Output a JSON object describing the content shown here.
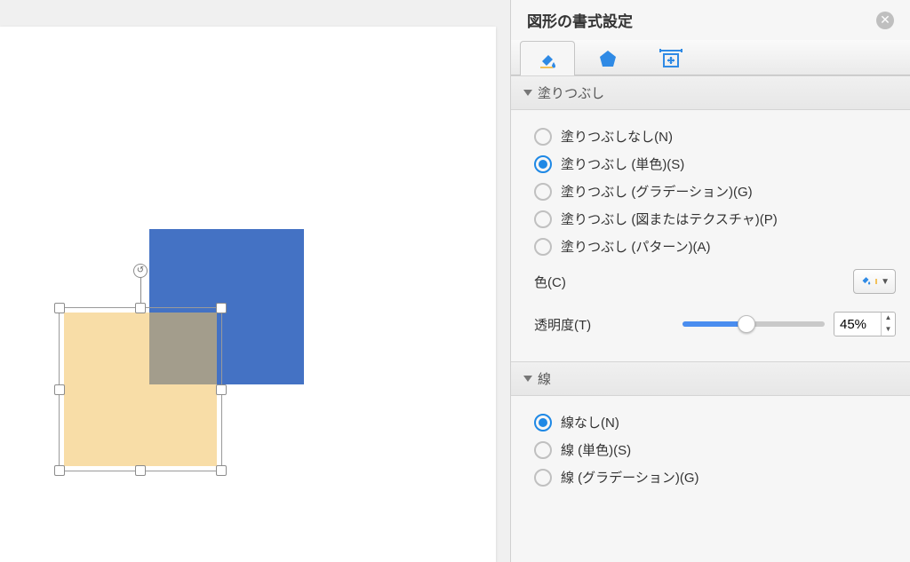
{
  "panel": {
    "title": "図形の書式設定"
  },
  "icons": {
    "close": "✕"
  },
  "tabs": {
    "fill": "fill-effects",
    "shape": "shape-options",
    "size": "size-properties"
  },
  "sections": {
    "fill": {
      "title": "塗りつぶし",
      "options": {
        "none": "塗りつぶしなし(N)",
        "solid": "塗りつぶし (単色)(S)",
        "grad": "塗りつぶし (グラデーション)(G)",
        "pic": "塗りつぶし (図またはテクスチャ)(P)",
        "pat": "塗りつぶし (パターン)(A)"
      },
      "selected": "solid",
      "color_label": "色(C)",
      "color_swatch": "#f2c15a",
      "opacity_label": "透明度(T)",
      "opacity_value": "45%",
      "opacity_percent": 45
    },
    "line": {
      "title": "線",
      "options": {
        "none": "線なし(N)",
        "solid": "線 (単色)(S)",
        "grad": "線 (グラデーション)(G)"
      },
      "selected": "none"
    }
  },
  "canvas": {
    "rotate_glyph": "↺"
  }
}
